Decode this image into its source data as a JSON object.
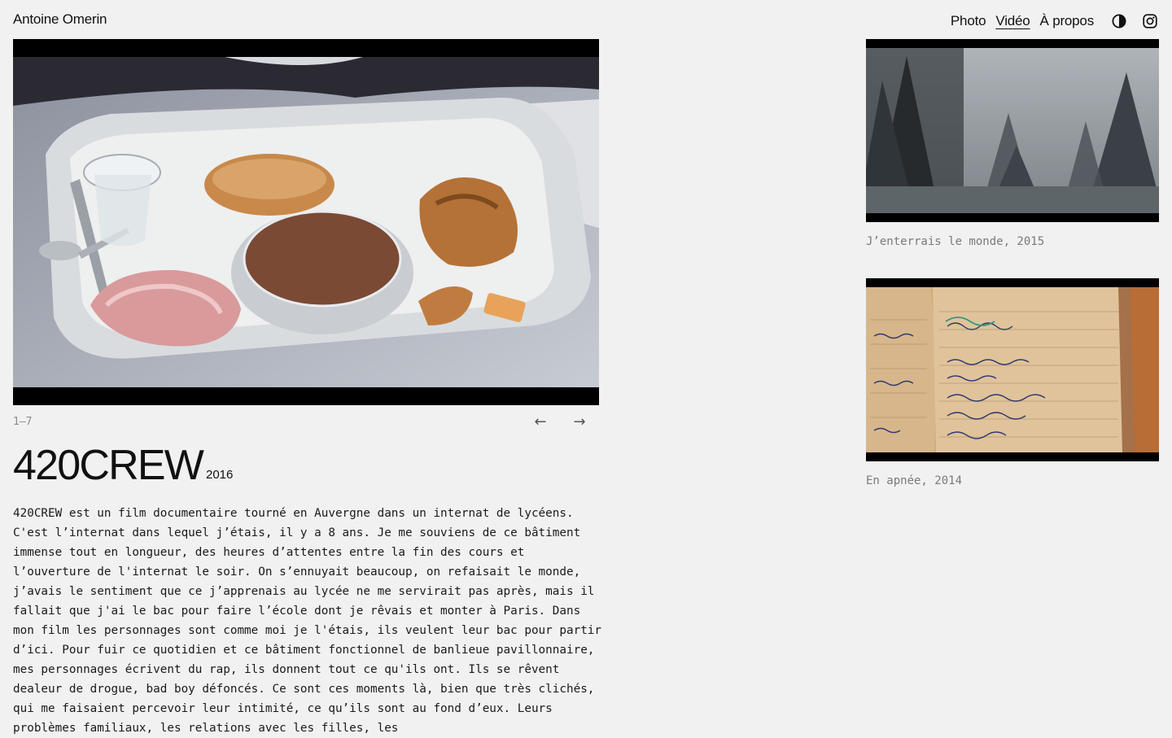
{
  "header": {
    "site_title": "Antoine Omerin",
    "nav": [
      {
        "label": "Photo",
        "active": false
      },
      {
        "label": "Vidéo",
        "active": true
      },
      {
        "label": "À propos",
        "active": false
      }
    ],
    "icons": [
      "contrast-icon",
      "instagram-icon"
    ]
  },
  "hero": {
    "counter": "1—7",
    "prev_arrow": "←",
    "next_arrow": "→"
  },
  "film": {
    "title": "420CREW",
    "year": "2016",
    "description": "420CREW est un film documentaire tourné en Auvergne dans un internat de lycéens. C'est l’internat dans lequel j’étais, il y a 8 ans. Je me souviens de ce bâtiment immense tout en longueur, des heures d’attentes entre la fin des cours et l’ouverture de l'internat le soir. On s’ennuyait beaucoup, on refaisait le monde, j’avais le sentiment que ce j’apprenais au lycée ne me servirait pas après, mais il fallait que j'ai le bac pour faire l’école dont je rêvais et monter à Paris. Dans mon film les personnages sont comme moi je l'étais, ils veulent leur bac pour partir d’ici. Pour fuir ce quotidien et ce bâtiment fonctionnel de banlieue pavillonnaire, mes personnages écrivent du rap, ils donnent tout ce qu'ils ont. Ils se rêvent dealeur de drogue, bad boy défoncés. Ce sont ces moments là, bien que très clichés, qui me faisaient percevoir leur intimité, ce qu’ils sont au fond d’eux. Leurs problèmes familiaux, les relations avec les filles, les"
  },
  "sidebar": {
    "films": [
      {
        "caption": "J’enterrais le monde, 2015"
      },
      {
        "caption": "En apnée, 2014"
      }
    ]
  },
  "colors": {
    "background": "#f1f1f1",
    "text": "#111111",
    "muted": "#7a7a7a",
    "letterbox": "#000000"
  }
}
